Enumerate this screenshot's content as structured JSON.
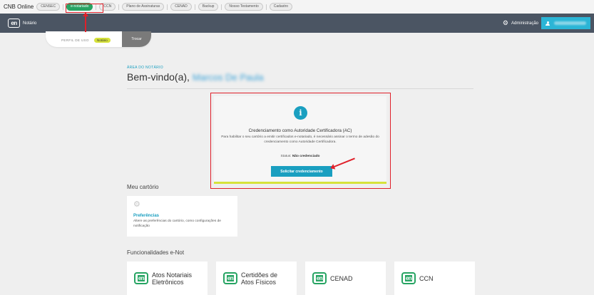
{
  "topbar": {
    "brand": "CNB Online",
    "tabs": [
      {
        "label": "CENSEC",
        "active": false
      },
      {
        "label": "e-notariado",
        "active": true
      },
      {
        "label": "CCN",
        "active": false
      },
      {
        "label": "Plano de Assinaturas",
        "active": false
      },
      {
        "label": "CENAD",
        "active": false
      },
      {
        "label": "Backup",
        "active": false
      },
      {
        "label": "Nosso Testamento",
        "active": false
      },
      {
        "label": "Cadastro",
        "active": false
      }
    ]
  },
  "appbar": {
    "logo": "en",
    "app_name": "Notário",
    "admin_label": "Administração",
    "admin_icon": "gear-icon",
    "user_icon": "user-icon"
  },
  "profile": {
    "label": "PERFIL DE USO",
    "value": "Notário",
    "switch_label": "Trocar"
  },
  "welcome": {
    "area_label": "ÁREA DO NOTÁRIO",
    "greeting": "Bem-vindo(a),",
    "user_name": "Marcos De Paula"
  },
  "credenciamento": {
    "icon": "info-icon",
    "title": "Credenciamento como Autoridade Certificadora (AC)",
    "description": "Para habilitar o seu cartório a emitir certificados e-notariado, é necessário assinar o termo de adesão do credenciamento como Autoridade Certificadora.",
    "status_label": "Status:",
    "status_value": "Não credenciado",
    "button_label": "Solicitar credenciamento"
  },
  "meu_cartorio": {
    "section_title": "Meu cartório",
    "preferences": {
      "icon": "gear-icon",
      "title": "Preferências",
      "description": "Altere as preferências do cartório, como configurações de notificação"
    }
  },
  "funcionalidades": {
    "section_title": "Funcionalidades e-Not",
    "items": [
      {
        "logo": "en",
        "label": "Atos Notariais\nEletrônicos"
      },
      {
        "logo": "en",
        "label": "Certidões de\nAtos Físicos"
      },
      {
        "logo": "en",
        "label": "CENAD"
      },
      {
        "logo": "en",
        "label": "CCN"
      }
    ]
  },
  "colors": {
    "header_bg": "#4b5563",
    "accent_blue": "#1a9fc0",
    "user_button": "#2bb5d6",
    "active_tab_green": "#27a463",
    "badge_yellow": "#d6e23b",
    "annotation_red": "#e0202a"
  }
}
